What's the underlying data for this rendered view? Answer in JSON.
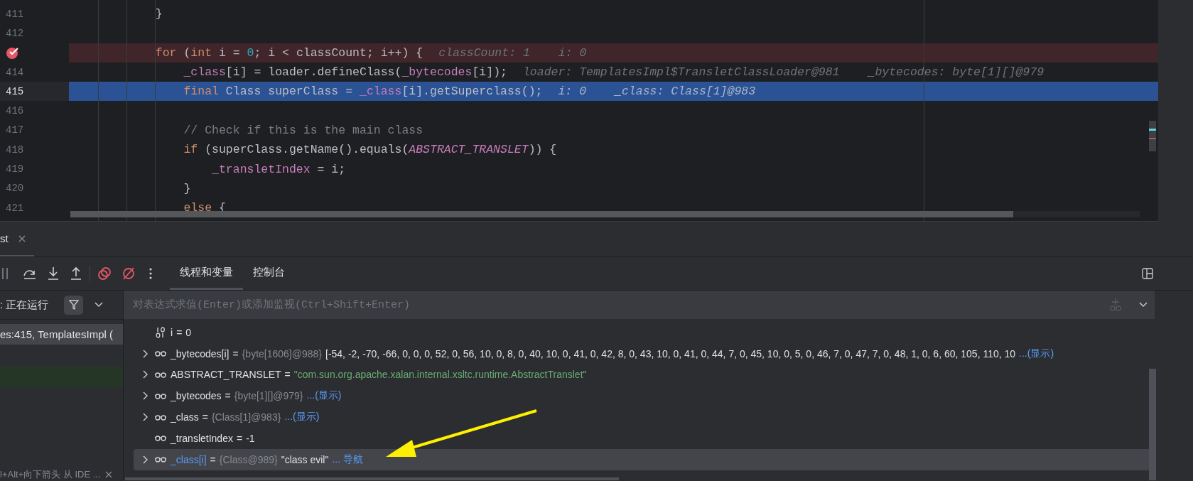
{
  "editor": {
    "lines": [
      {
        "number": "411",
        "kind": "normal",
        "code": [
          {
            "text": "            }",
            "kind": "plain"
          }
        ]
      },
      {
        "number": "412",
        "kind": "normal"
      },
      {
        "kind": "breakpoint",
        "code": [
          {
            "text": "            for",
            "kind": "keyword"
          },
          {
            "text": " (",
            "kind": "plain"
          },
          {
            "text": "int",
            "kind": "keyword"
          },
          {
            "text": " i = ",
            "kind": "plain"
          },
          {
            "text": "0",
            "kind": "number"
          },
          {
            "text": "; i < classCount; i++) {",
            "kind": "plain"
          }
        ],
        "hints": [
          "classCount: 1",
          "i: 0"
        ]
      },
      {
        "number": "414",
        "kind": "normal",
        "code": [
          {
            "text": "                _class",
            "kind": "field"
          },
          {
            "text": "[i] = loader.defineClass(",
            "kind": "plain"
          },
          {
            "text": "_bytecodes",
            "kind": "field"
          },
          {
            "text": "[i]);",
            "kind": "plain"
          }
        ],
        "hints": [
          "loader: TemplatesImpl$TransletClassLoader@981",
          "_bytecodes: byte[1][]@979"
        ]
      },
      {
        "number": "415",
        "kind": "current",
        "code": [
          {
            "text": "                final",
            "kind": "keyword"
          },
          {
            "text": " Class superClass = ",
            "kind": "plain"
          },
          {
            "text": "_class",
            "kind": "field"
          },
          {
            "text": "[i].getSuperclass();",
            "kind": "plain"
          }
        ],
        "hints": [
          "i: 0",
          "_class: Class[1]@983"
        ]
      },
      {
        "number": "416",
        "kind": "normal"
      },
      {
        "number": "417",
        "kind": "normal",
        "code": [
          {
            "text": "                // Check if this is the main class",
            "kind": "comment"
          }
        ]
      },
      {
        "number": "418",
        "kind": "normal",
        "code": [
          {
            "text": "                if",
            "kind": "keyword"
          },
          {
            "text": " (superClass.getName().equals(",
            "kind": "plain"
          },
          {
            "text": "ABSTRACT_TRANSLET",
            "kind": "constant"
          },
          {
            "text": ")) {",
            "kind": "plain"
          }
        ]
      },
      {
        "number": "419",
        "kind": "normal",
        "code": [
          {
            "text": "                    _transletIndex",
            "kind": "field"
          },
          {
            "text": " = i;",
            "kind": "plain"
          }
        ]
      },
      {
        "number": "420",
        "kind": "normal",
        "code": [
          {
            "text": "                }",
            "kind": "plain"
          }
        ]
      },
      {
        "number": "421",
        "kind": "normal",
        "code": [
          {
            "text": "                else",
            "kind": "keyword"
          },
          {
            "text": " {",
            "kind": "plain"
          }
        ]
      }
    ]
  },
  "debug": {
    "tool_tab": {
      "label": "st"
    },
    "tabs": [
      {
        "label": "线程和变量",
        "selected": true
      },
      {
        "label": "控制台",
        "selected": false
      }
    ],
    "thread_filter": {
      "label": ": 正在运行"
    },
    "frames": [
      {
        "label": "es:415, TemplatesImpl (",
        "selected": true,
        "kind": "normal"
      },
      {
        "selected": false,
        "kind": "highlighted"
      }
    ],
    "hint_bar": {
      "text": "l+Alt+向下箭头 从 IDE ..."
    },
    "expression": {
      "placeholder": "对表达式求值(Enter)或添加监视(Ctrl+Shift+Enter)"
    },
    "variables": [
      {
        "kind": "primitive",
        "expandable": false,
        "selected": false,
        "name": "i",
        "changed": false,
        "operator": "=",
        "value": {
          "text": "0",
          "kind": "plain"
        }
      },
      {
        "kind": "field",
        "expandable": true,
        "selected": false,
        "name": "_bytecodes[i]",
        "changed": false,
        "operator": "=",
        "type": "{byte[1606]@988}",
        "value": {
          "text": "[-54, -2, -70, -66, 0, 0, 0, 52, 0, 56, 10, 0, 8, 0, 40, 10, 0, 41, 0, 42, 8, 0, 43, 10, 0, 41, 0, 44, 7, 0, 45, 10, 0, 5, 0, 46, 7, 0, 47, 7, 0, 48, 1, 0, 6, 60, 105, 110, 10",
          "kind": "plain"
        },
        "link": "...(显示)"
      },
      {
        "kind": "field",
        "expandable": true,
        "selected": false,
        "name": "ABSTRACT_TRANSLET",
        "changed": false,
        "operator": "=",
        "value": {
          "text": "\"com.sun.org.apache.xalan.internal.xsltc.runtime.AbstractTranslet\"",
          "kind": "string"
        }
      },
      {
        "kind": "field",
        "expandable": true,
        "selected": false,
        "name": "_bytecodes",
        "changed": false,
        "operator": "=",
        "type": "{byte[1][]@979}",
        "link": "...(显示)"
      },
      {
        "kind": "field",
        "expandable": true,
        "selected": false,
        "name": "_class",
        "changed": false,
        "operator": "=",
        "type": "{Class[1]@983}",
        "link": "...(显示)"
      },
      {
        "kind": "field",
        "expandable": false,
        "selected": false,
        "name": "_transletIndex",
        "changed": false,
        "operator": "=",
        "value": {
          "text": "-1",
          "kind": "plain"
        }
      },
      {
        "kind": "field",
        "expandable": true,
        "selected": true,
        "name": "_class[i]",
        "changed": true,
        "operator": "=",
        "type": "{Class@989}",
        "value": {
          "text": "\"class evil\"",
          "kind": "plain"
        },
        "link": "... 导航"
      }
    ]
  }
}
